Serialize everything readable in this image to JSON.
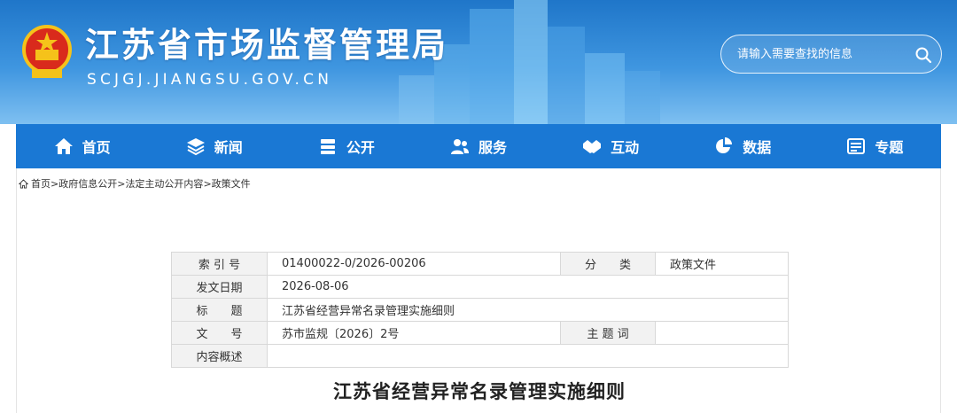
{
  "header": {
    "site_title": "江苏省市场监督管理局",
    "site_domain": "SCJGJ.JIANGSU.GOV.CN",
    "search_placeholder": "请输入需要查找的信息",
    "banner_color": "#2b84d6"
  },
  "nav": {
    "items": [
      {
        "label": "首页",
        "icon": "home-icon"
      },
      {
        "label": "新闻",
        "icon": "layers-icon"
      },
      {
        "label": "公开",
        "icon": "document-stack-icon"
      },
      {
        "label": "服务",
        "icon": "users-icon"
      },
      {
        "label": "互动",
        "icon": "handshake-icon"
      },
      {
        "label": "数据",
        "icon": "pie-chart-icon"
      },
      {
        "label": "专题",
        "icon": "window-icon"
      }
    ]
  },
  "breadcrumb": {
    "home": "首页",
    "items": [
      "政府信息公开",
      "法定主动公开内容",
      "政策文件"
    ]
  },
  "meta_table": {
    "index_label": "索 引 号",
    "index_value": "01400022-0/2026-00206",
    "category_label": "分　　类",
    "category_value": "政策文件",
    "date_label": "发文日期",
    "date_value": "2026-08-06",
    "title_label": "标　　题",
    "title_value": "江苏省经营异常名录管理实施细则",
    "docno_label": "文　　号",
    "docno_value": "苏市监规〔2026〕2号",
    "keywords_label": "主 题 词",
    "keywords_value": "",
    "summary_label": "内容概述",
    "summary_value": ""
  },
  "document": {
    "title": "江苏省经营异常名录管理实施细则"
  }
}
